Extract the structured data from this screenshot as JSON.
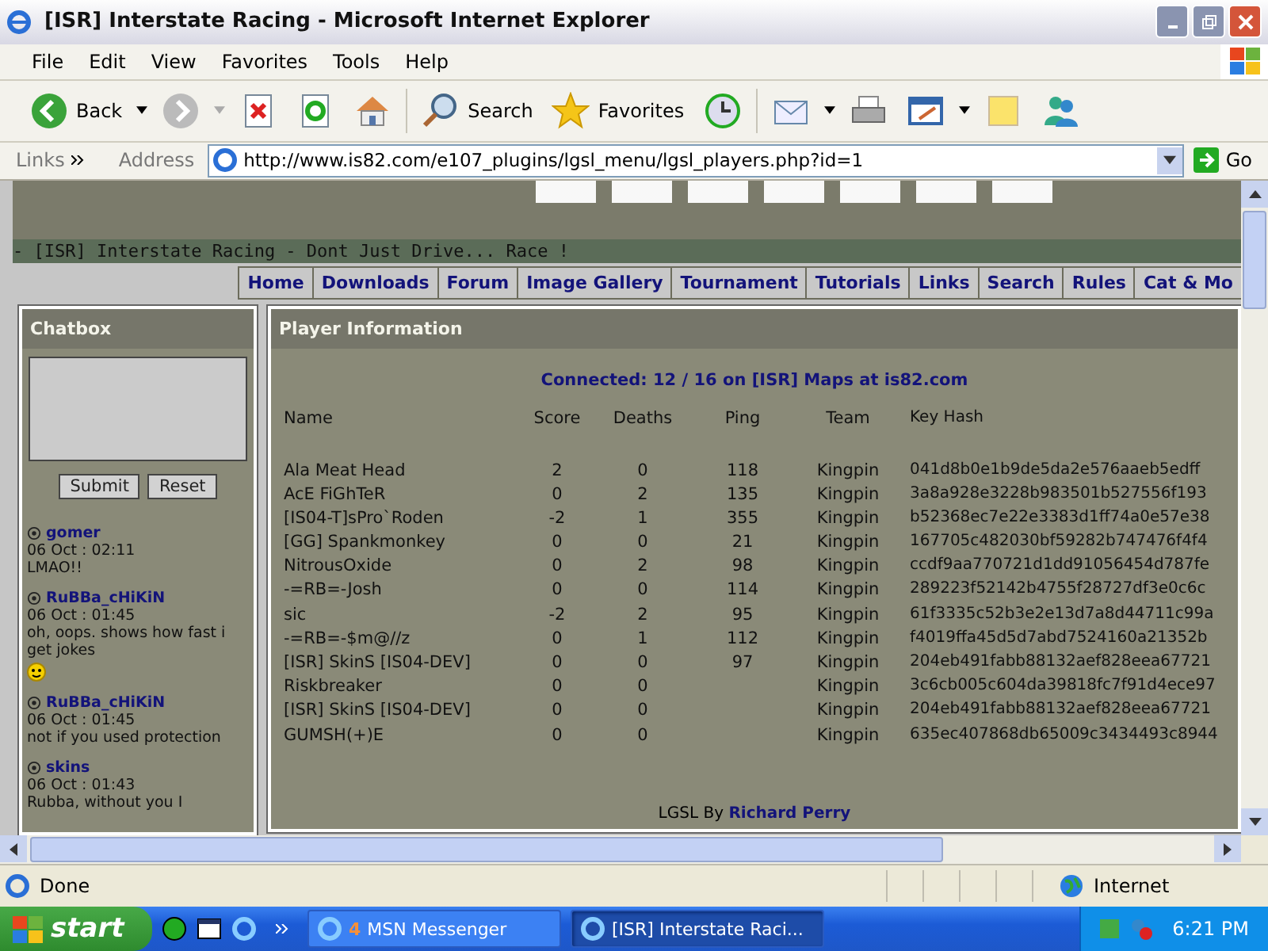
{
  "window": {
    "title": "[ISR] Interstate Racing - Microsoft Internet Explorer"
  },
  "menu": [
    "File",
    "Edit",
    "View",
    "Favorites",
    "Tools",
    "Help"
  ],
  "toolbar": {
    "back": "Back",
    "search": "Search",
    "favorites": "Favorites"
  },
  "address_bar": {
    "links": "Links",
    "label": "Address",
    "url": "http://www.is82.com/e107_plugins/lgsl_menu/lgsl_players.php?id=1",
    "go": "Go"
  },
  "page": {
    "tagline": "- [ISR] Interstate Racing - Dont Just Drive... Race !",
    "nav": [
      "Home",
      "Downloads",
      "Forum",
      "Image Gallery",
      "Tournament",
      "Tutorials",
      "Links",
      "Search",
      "Rules",
      "Cat & Mo"
    ],
    "chatbox": {
      "title": "Chatbox",
      "submit": "Submit",
      "reset": "Reset",
      "messages": [
        {
          "author": "gomer",
          "time": "06 Oct : 02:11",
          "text": "LMAO!!",
          "smiley": false
        },
        {
          "author": "RuBBa_cHiKiN",
          "time": "06 Oct : 01:45",
          "text": "oh, oops. shows how fast i get jokes",
          "smiley": true
        },
        {
          "author": "RuBBa_cHiKiN",
          "time": "06 Oct : 01:45",
          "text": "not if you used protection",
          "smiley": false
        },
        {
          "author": "skins",
          "time": "06 Oct : 01:43",
          "text": "Rubba, without you I",
          "smiley": false
        }
      ]
    },
    "players": {
      "title": "Player Information",
      "connected": "Connected: 12 / 16 on [ISR] Maps at is82.com",
      "columns": [
        "Name",
        "Score",
        "Deaths",
        "Ping",
        "Team",
        "Key Hash"
      ],
      "rows": [
        [
          "Ala Meat Head",
          "2",
          "0",
          "118",
          "Kingpin",
          "041d8b0e1b9de5da2e576aaeb5edff"
        ],
        [
          "AcE FiGhTeR",
          "0",
          "2",
          "135",
          "Kingpin",
          "3a8a928e3228b983501b527556f193"
        ],
        [
          "[IS04-T]sPro`Roden",
          "-2",
          "1",
          "355",
          "Kingpin",
          "b52368ec7e22e3383d1ff74a0e57e38"
        ],
        [
          "[GG] Spankmonkey",
          "0",
          "0",
          "21",
          "Kingpin",
          "167705c482030bf59282b747476f4f4"
        ],
        [
          "NitrousOxide",
          "0",
          "2",
          "98",
          "Kingpin",
          "ccdf9aa770721d1dd91056454d787fe"
        ],
        [
          "-=RB=-Josh",
          "0",
          "0",
          "114",
          "Kingpin",
          "289223f52142b4755f28727df3e0c6c"
        ],
        [
          "sic",
          "-2",
          "2",
          "95",
          "Kingpin",
          "61f3335c52b3e2e13d7a8d44711c99a"
        ],
        [
          "-=RB=-$m@//z",
          "0",
          "1",
          "112",
          "Kingpin",
          "f4019ffa45d5d7abd7524160a21352b"
        ],
        [
          "[ISR] SkinS [IS04-DEV]",
          "0",
          "0",
          "97",
          "Kingpin",
          "204eb491fabb88132aef828eea67721"
        ],
        [
          "Riskbreaker",
          "0",
          "0",
          "",
          "Kingpin",
          "3c6cb005c604da39818fc7f91d4ece97"
        ],
        [
          "[ISR] SkinS [IS04-DEV]",
          "0",
          "0",
          "",
          "Kingpin",
          "204eb491fabb88132aef828eea67721"
        ],
        [
          "GUMSH(+)E",
          "0",
          "0",
          "",
          "Kingpin",
          "635ec407868db65009c3434493c8944"
        ]
      ],
      "footer": "LGSL By",
      "footer_link": "Richard Perry"
    }
  },
  "status_bar": {
    "text": "Done",
    "zone": "Internet"
  },
  "taskbar": {
    "start": "start",
    "tasks": [
      {
        "count": "4",
        "label": "MSN Messenger",
        "selected": false
      },
      {
        "label": "[ISR] Interstate Raci...",
        "selected": true
      }
    ],
    "clock": "6:21 PM"
  }
}
